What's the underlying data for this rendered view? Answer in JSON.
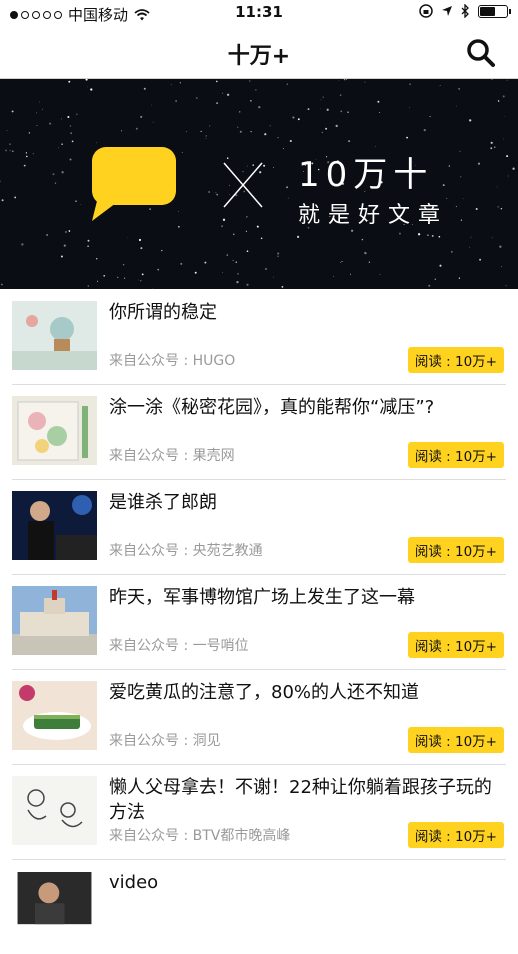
{
  "status": {
    "carrier": "中国移动",
    "time": "11:31"
  },
  "header": {
    "title": "十万+"
  },
  "banner": {
    "big": "10万十",
    "sub": "就是好文章",
    "cross": "×"
  },
  "articles": [
    {
      "title": "你所谓的稳定",
      "source": "来自公众号 : HUGO",
      "reads": "阅读 : 10万+"
    },
    {
      "title": "涂一涂《秘密花园》，真的能帮你“减压”?",
      "source": "来自公众号 : 果壳网",
      "reads": "阅读 : 10万+"
    },
    {
      "title": "是谁杀了郎朗",
      "source": "来自公众号 : 央苑艺教通",
      "reads": "阅读 : 10万+"
    },
    {
      "title": "昨天，军事博物馆广场上发生了这一幕",
      "source": "来自公众号 : 一号哨位",
      "reads": "阅读 : 10万+"
    },
    {
      "title": "爱吃黄瓜的注意了，80%的人还不知道",
      "source": "来自公众号 : 洞见",
      "reads": "阅读 : 10万+"
    },
    {
      "title": "懒人父母拿去！不谢！22种让你躺着跟孩子玩的方法",
      "source": "来自公众号 : BTV都市晚高峰",
      "reads": "阅读 : 10万+"
    },
    {
      "title": "video"
    }
  ]
}
